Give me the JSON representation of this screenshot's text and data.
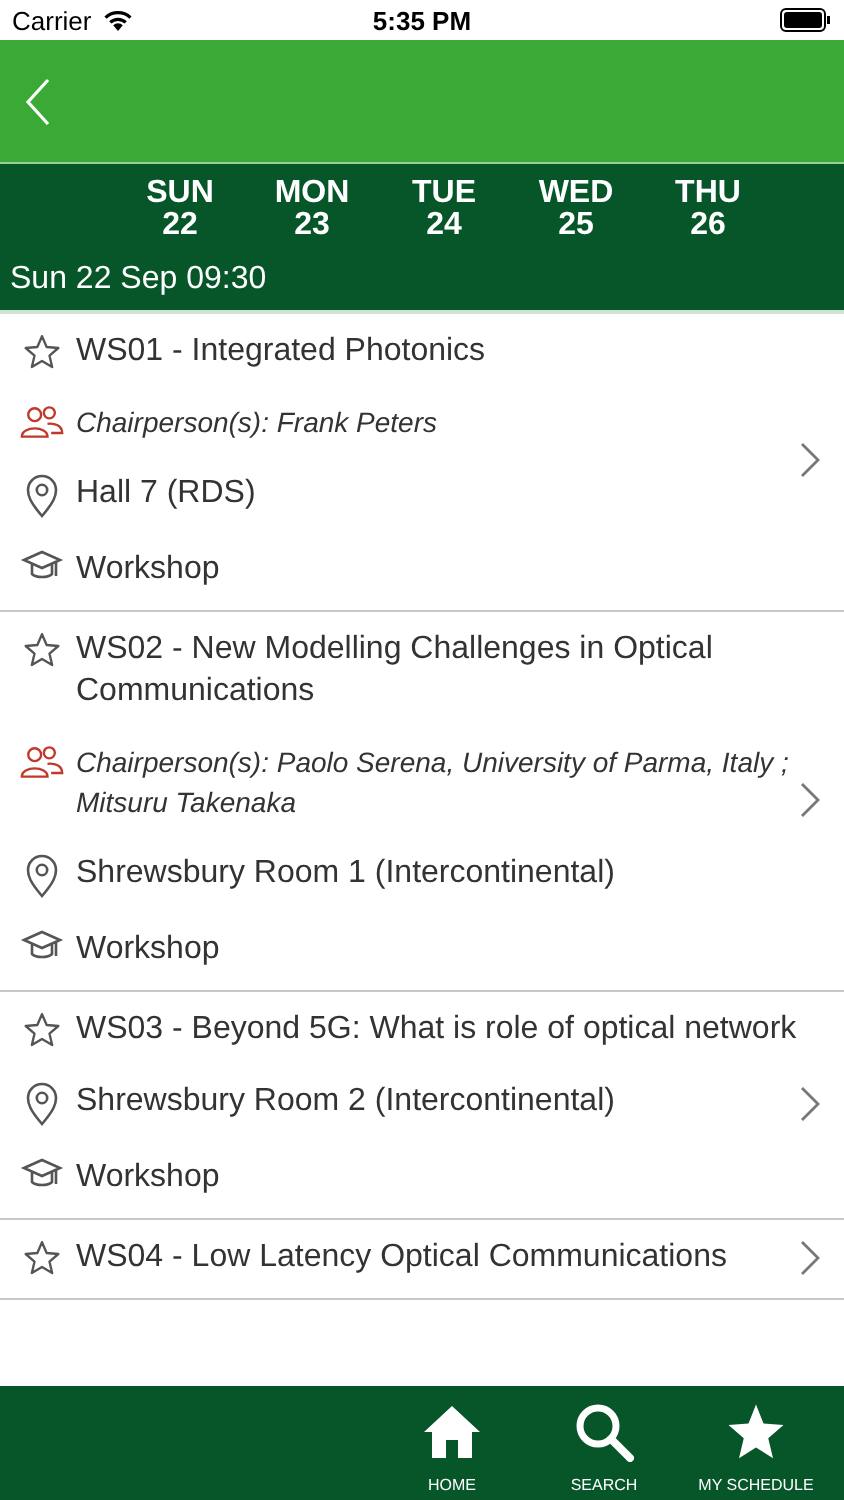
{
  "status_bar": {
    "carrier": "Carrier",
    "time": "5:35 PM"
  },
  "days": [
    {
      "weekday": "SUN",
      "date": "22"
    },
    {
      "weekday": "MON",
      "date": "23"
    },
    {
      "weekday": "TUE",
      "date": "24"
    },
    {
      "weekday": "WED",
      "date": "25"
    },
    {
      "weekday": "THU",
      "date": "26"
    }
  ],
  "slot": "Sun 22 Sep 09:30",
  "sessions": [
    {
      "title": "WS01 - Integrated Photonics",
      "starred": false,
      "chairs": "Chairperson(s): Frank Peters",
      "venue": "Hall 7 (RDS)",
      "type": "Workshop"
    },
    {
      "title": "WS02 - New Modelling Challenges in Optical Communications",
      "starred": false,
      "chairs": "Chairperson(s): Paolo Serena, University of Parma, Italy ; Mitsuru Takenaka",
      "venue": "Shrewsbury Room 1 (Intercontinental)",
      "type": "Workshop"
    },
    {
      "title": "WS03 - Beyond 5G: What is role of optical network",
      "starred": false,
      "venue": "Shrewsbury Room 2 (Intercontinental)",
      "type": "Workshop"
    },
    {
      "title": "WS04 - Low Latency Optical Communications",
      "starred": false
    }
  ],
  "tabs": [
    {
      "label": "HOME",
      "kind": "home"
    },
    {
      "label": "SEARCH",
      "kind": "search"
    },
    {
      "label": "MY SCHEDULE",
      "kind": "star"
    }
  ]
}
